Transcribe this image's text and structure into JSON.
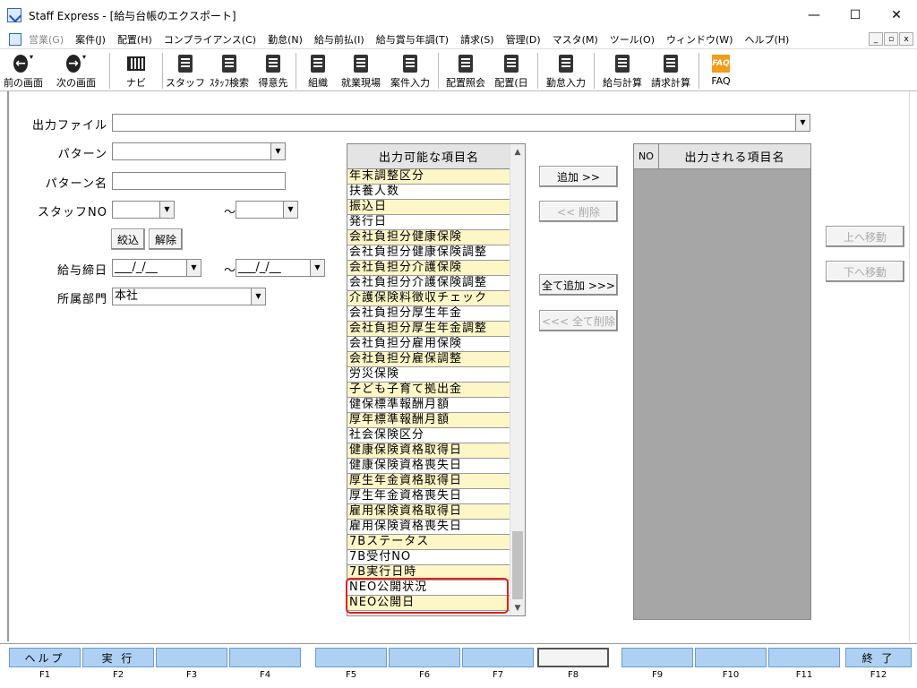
{
  "window": {
    "title": "Staff Express - [給与台帳のエクスポート]",
    "min": "—",
    "max": "☐",
    "close": "✕"
  },
  "menu": [
    {
      "label": "営業(G)",
      "disabled": true
    },
    {
      "label": "案件(J)",
      "disabled": false
    },
    {
      "label": "配置(H)",
      "disabled": false
    },
    {
      "label": "コンプライアンス(C)",
      "disabled": false
    },
    {
      "label": "勤怠(N)",
      "disabled": false
    },
    {
      "label": "給与前払(I)",
      "disabled": false
    },
    {
      "label": "給与賞与年調(T)",
      "disabled": false
    },
    {
      "label": "請求(S)",
      "disabled": false
    },
    {
      "label": "管理(D)",
      "disabled": false
    },
    {
      "label": "マスタ(M)",
      "disabled": false
    },
    {
      "label": "ツール(O)",
      "disabled": false
    },
    {
      "label": "ウィンドウ(W)",
      "disabled": false
    },
    {
      "label": "ヘルプ(H)",
      "disabled": false
    }
  ],
  "mdi": {
    "min": "_",
    "restore": "▫",
    "close": "x"
  },
  "toolbar": {
    "back": "前の画面",
    "forward": "次の画面",
    "navi": "ナビ",
    "staff": "スタッフ",
    "staff_search": "ｽﾀｯﾌ検索",
    "customer": "得意先",
    "org": "組織",
    "site": "就業現場",
    "case_input": "案件入力",
    "assign_ref": "配置照会",
    "assign_day": "配置(日",
    "attend_input": "勤怠入力",
    "salary_calc": "給与計算",
    "billing_calc": "請求計算",
    "faq": "FAQ",
    "faq_icon_text": "FAQ"
  },
  "form": {
    "output_file_label": "出力ファイル",
    "output_file_value": "",
    "pattern_label": "パターン",
    "pattern_value": "",
    "pattern_name_label": "パターン名",
    "pattern_name_value": "",
    "staff_no_label": "スタッフNO",
    "staff_no_from": "",
    "staff_no_to": "",
    "tilde": "～",
    "filter_button": "絞込",
    "clear_button": "解除",
    "pay_close_label": "給与締日",
    "pay_close_from": "___/_/__",
    "pay_close_to": "___/_/__",
    "dept_label": "所属部門",
    "dept_value": "本社"
  },
  "available": {
    "header": "出力可能な項目名",
    "items": [
      {
        "label": "年末調整区分",
        "bg": "y"
      },
      {
        "label": "扶養人数",
        "bg": "w"
      },
      {
        "label": "振込日",
        "bg": "y"
      },
      {
        "label": "発行日",
        "bg": "w"
      },
      {
        "label": "会社負担分健康保険",
        "bg": "y"
      },
      {
        "label": "会社負担分健康保険調整",
        "bg": "w"
      },
      {
        "label": "会社負担分介護保険",
        "bg": "y"
      },
      {
        "label": "会社負担分介護保険調整",
        "bg": "w"
      },
      {
        "label": "介護保険料徴収チェック",
        "bg": "y"
      },
      {
        "label": "会社負担分厚生年金",
        "bg": "w"
      },
      {
        "label": "会社負担分厚生年金調整",
        "bg": "y"
      },
      {
        "label": "会社負担分雇用保険",
        "bg": "w"
      },
      {
        "label": "会社負担分雇保調整",
        "bg": "y"
      },
      {
        "label": "労災保険",
        "bg": "w"
      },
      {
        "label": "子ども子育て拠出金",
        "bg": "y"
      },
      {
        "label": "健保標準報酬月額",
        "bg": "w"
      },
      {
        "label": "厚年標準報酬月額",
        "bg": "y"
      },
      {
        "label": "社会保険区分",
        "bg": "w"
      },
      {
        "label": "健康保険資格取得日",
        "bg": "y"
      },
      {
        "label": "健康保険資格喪失日",
        "bg": "w"
      },
      {
        "label": "厚生年金資格取得日",
        "bg": "y"
      },
      {
        "label": "厚生年金資格喪失日",
        "bg": "w"
      },
      {
        "label": "雇用保険資格取得日",
        "bg": "y"
      },
      {
        "label": "雇用保険資格喪失日",
        "bg": "w"
      },
      {
        "label": "7Bステータス",
        "bg": "y"
      },
      {
        "label": "7B受付NO",
        "bg": "w"
      },
      {
        "label": "7B実行日時",
        "bg": "y"
      },
      {
        "label": "NEO公開状況",
        "bg": "w"
      },
      {
        "label": "NEO公開日",
        "bg": "y"
      }
    ]
  },
  "actions": {
    "add": "追加 >>",
    "remove": "<< 削除",
    "add_all": "全て追加 >>>",
    "remove_all": "<<< 全て削除",
    "move_up": "上へ移動",
    "move_down": "下へ移動"
  },
  "output": {
    "no_header": "NO",
    "name_header": "出力される項目名"
  },
  "fkeys": [
    {
      "label": "ヘルプ",
      "key": "F1"
    },
    {
      "label": "実 行",
      "key": "F2"
    },
    {
      "label": "",
      "key": "F3"
    },
    {
      "label": "",
      "key": "F4"
    },
    {
      "label": "",
      "key": "F5"
    },
    {
      "label": "",
      "key": "F6"
    },
    {
      "label": "",
      "key": "F7"
    },
    {
      "label": "",
      "key": "F8"
    },
    {
      "label": "",
      "key": "F9"
    },
    {
      "label": "",
      "key": "F10"
    },
    {
      "label": "",
      "key": "F11"
    },
    {
      "label": "終 了",
      "key": "F12"
    }
  ],
  "colors": {
    "accent_highlight": "#e02020",
    "fkey_blue": "#aed0f3",
    "row_yellow": "#fdf6c7"
  }
}
